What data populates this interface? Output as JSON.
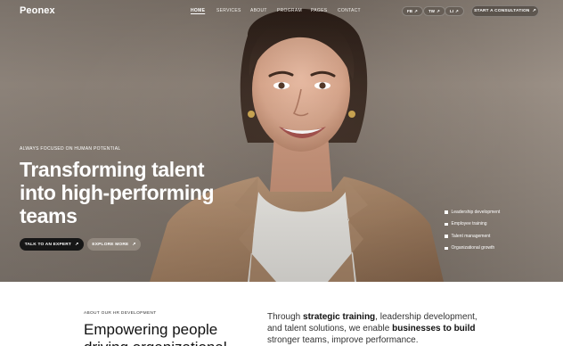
{
  "brand": {
    "logo": "Peonex"
  },
  "nav": {
    "items": [
      "HOME",
      "SERVICES",
      "ABOUT",
      "PROGRAM",
      "PAGES",
      "CONTACT"
    ],
    "active_index": 0
  },
  "social": [
    {
      "label": "FB",
      "icon": "arrow-up-right-icon"
    },
    {
      "label": "TW",
      "icon": "arrow-up-right-icon"
    },
    {
      "label": "LI",
      "icon": "arrow-up-right-icon"
    }
  ],
  "header_cta": {
    "label": "START A CONSULTATION",
    "icon": "arrow-up-right-icon"
  },
  "hero": {
    "eyebrow": "ALWAYS FOCUSED ON HUMAN POTENTIAL",
    "headline_lines": [
      "Transforming talent",
      "into high-performing",
      "teams"
    ],
    "primary_button": "TALK TO AN EXPERT",
    "secondary_button": "EXPLORE MORE",
    "arrow_glyph": "↗",
    "services": [
      "Leadership development",
      "Employee training",
      "Talent management",
      "Organizational growth"
    ]
  },
  "about": {
    "label": "ABOUT OUR HR DEVELOPMENT",
    "title": "Empowering people driving organizational",
    "text_parts": [
      {
        "t": "Through ",
        "b": false
      },
      {
        "t": "strategic training",
        "b": true
      },
      {
        "t": ", leadership development, and talent solutions, we enable ",
        "b": false
      },
      {
        "t": "businesses to build",
        "b": true
      },
      {
        "t": " stronger teams, improve performance.",
        "b": false
      }
    ]
  },
  "colors": {
    "hero_bg": "#857a70",
    "primary_button_bg": "#161616",
    "text_dark": "#111111",
    "blazer": "#b08d6e"
  }
}
